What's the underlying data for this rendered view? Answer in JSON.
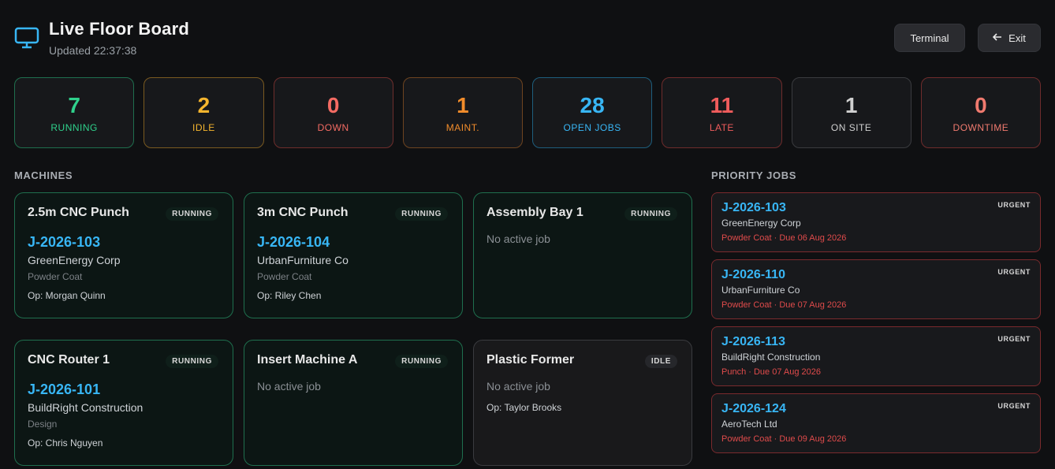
{
  "header": {
    "title": "Live Floor Board",
    "updated": "Updated 22:37:38",
    "buttons": {
      "terminal": "Terminal",
      "exit": "Exit"
    },
    "icons": {
      "monitor": "monitor-icon",
      "exit_arrow": "arrow-left-icon"
    }
  },
  "colors": {
    "accent_blue": "#38b6f5",
    "running_green": "#2fd18c",
    "idle_amber": "#f5b52e",
    "down_red": "#f46b63",
    "maint_orange": "#f18c2b",
    "late_red": "#f05c5c"
  },
  "stats": [
    {
      "value": "7",
      "label": "RUNNING",
      "color": "#2fd18c",
      "border": "#1f6f4e"
    },
    {
      "value": "2",
      "label": "IDLE",
      "color": "#f5b52e",
      "border": "#7a5a20"
    },
    {
      "value": "0",
      "label": "DOWN",
      "color": "#f46b63",
      "border": "#6f2e2c"
    },
    {
      "value": "1",
      "label": "MAINT.",
      "color": "#f18c2b",
      "border": "#6e4420"
    },
    {
      "value": "28",
      "label": "OPEN JOBS",
      "color": "#38b6f5",
      "border": "#1e5e7d"
    },
    {
      "value": "11",
      "label": "LATE",
      "color": "#f05c5c",
      "border": "#6f2c2c"
    },
    {
      "value": "1",
      "label": "ON SITE",
      "color": "#d0d0d0",
      "border": "#3a3b3f"
    },
    {
      "value": "0",
      "label": "DOWNTIME",
      "color": "#f07a6f",
      "border": "#6f2c2c"
    }
  ],
  "sections": {
    "machines": "MACHINES",
    "priority_jobs": "PRIORITY JOBS"
  },
  "machines": [
    {
      "name": "2.5m CNC Punch",
      "status": "RUNNING",
      "job": "J-2026-103",
      "customer": "GreenEnergy Corp",
      "process": "Powder Coat",
      "operator": "Op: Morgan Quinn"
    },
    {
      "name": "3m CNC Punch",
      "status": "RUNNING",
      "job": "J-2026-104",
      "customer": "UrbanFurniture Co",
      "process": "Powder Coat",
      "operator": "Op: Riley Chen"
    },
    {
      "name": "Assembly Bay 1",
      "status": "RUNNING",
      "no_job": "No active job"
    },
    {
      "name": "CNC Router 1",
      "status": "RUNNING",
      "job": "J-2026-101",
      "customer": "BuildRight Construction",
      "process": "Design",
      "operator": "Op: Chris Nguyen"
    },
    {
      "name": "Insert Machine A",
      "status": "RUNNING",
      "no_job": "No active job"
    },
    {
      "name": "Plastic Former",
      "status": "IDLE",
      "no_job": "No active job",
      "operator": "Op: Taylor Brooks"
    }
  ],
  "priority_jobs": [
    {
      "id": "J-2026-103",
      "customer": "GreenEnergy Corp",
      "meta": "Powder Coat · Due 06 Aug 2026",
      "tag": "URGENT"
    },
    {
      "id": "J-2026-110",
      "customer": "UrbanFurniture Co",
      "meta": "Powder Coat · Due 07 Aug 2026",
      "tag": "URGENT"
    },
    {
      "id": "J-2026-113",
      "customer": "BuildRight Construction",
      "meta": "Punch · Due 07 Aug 2026",
      "tag": "URGENT"
    },
    {
      "id": "J-2026-124",
      "customer": "AeroTech Ltd",
      "meta": "Powder Coat · Due 09 Aug 2026",
      "tag": "URGENT"
    }
  ]
}
